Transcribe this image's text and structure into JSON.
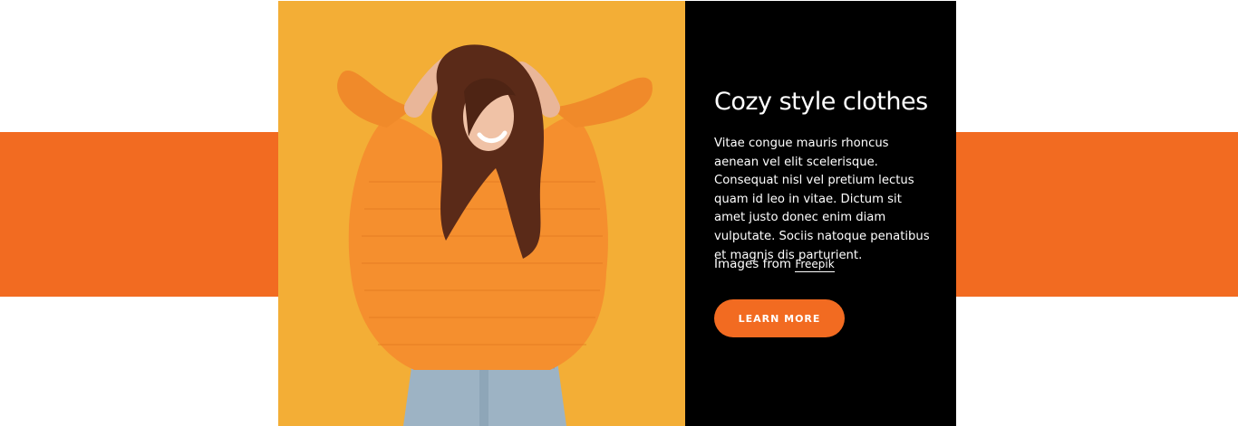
{
  "colors": {
    "accent": "#f26b21",
    "photo_background": "#f3ae36",
    "panel_background": "#000000",
    "page_background": "#ffffff"
  },
  "hero": {
    "image": {
      "icon": "woman-in-orange-sweater-photo"
    },
    "title": "Cozy style clothes",
    "description": "Vitae congue mauris rhoncus aenean vel elit scelerisque. Consequat nisl vel pretium lectus quam id leo in vitae. Dictum sit amet justo donec enim diam vulputate. Sociis natoque penatibus et magnis dis parturient.",
    "credit_prefix": "Images from",
    "credit_link": "Freepik",
    "cta_label": "LEARN MORE"
  }
}
